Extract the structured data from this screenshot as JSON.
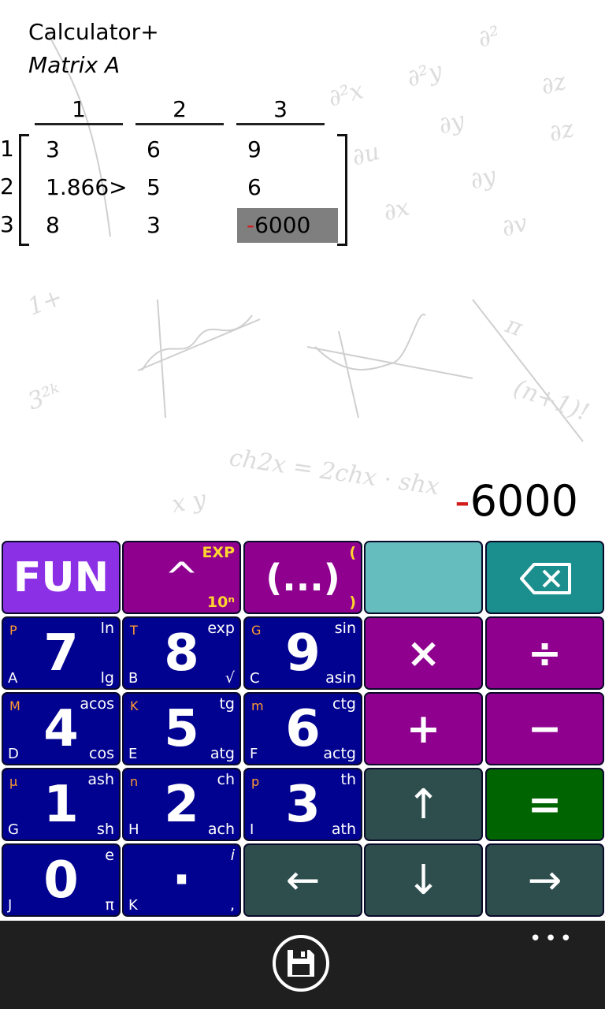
{
  "header": {
    "title": "Calculator+",
    "subtitle": "Matrix A"
  },
  "matrix": {
    "col_headers": [
      "1",
      "2",
      "3"
    ],
    "row_headers": [
      "1",
      "2",
      "3"
    ],
    "rows": [
      [
        "3",
        "6",
        "9"
      ],
      [
        "1.866>",
        "5",
        "6"
      ],
      [
        "8",
        "3",
        "6000"
      ]
    ],
    "selected_sign": "-"
  },
  "display": {
    "sign": "-",
    "value": "6000"
  },
  "keys": {
    "fun": "FUN",
    "pow": {
      "main": "^",
      "tr": "EXP",
      "br": "10ⁿ"
    },
    "paren": {
      "main": "(...)",
      "tr": "(",
      "br": ")"
    },
    "k7": {
      "main": "7",
      "tl": "P",
      "tr": "ln",
      "bl": "A",
      "br": "lg"
    },
    "k8": {
      "main": "8",
      "tl": "T",
      "tr": "exp",
      "bl": "B",
      "br": "√"
    },
    "k9": {
      "main": "9",
      "tl": "G",
      "tr": "sin",
      "bl": "C",
      "br": "asin"
    },
    "k4": {
      "main": "4",
      "tl": "M",
      "tr": "acos",
      "bl": "D",
      "br": "cos"
    },
    "k5": {
      "main": "5",
      "tl": "K",
      "tr": "tg",
      "bl": "E",
      "br": "atg"
    },
    "k6": {
      "main": "6",
      "tl": "m",
      "tr": "ctg",
      "bl": "F",
      "br": "actg"
    },
    "k1": {
      "main": "1",
      "tl": "μ",
      "tr": "ash",
      "bl": "G",
      "br": "sh"
    },
    "k2": {
      "main": "2",
      "tl": "n",
      "tr": "ch",
      "bl": "H",
      "br": "ach"
    },
    "k3": {
      "main": "3",
      "tl": "p",
      "tr": "th",
      "bl": "I",
      "br": "ath"
    },
    "k0": {
      "main": "0",
      "tr": "e",
      "bl": "J",
      "br": "π"
    },
    "dot": {
      "main": "·",
      "tr": "i",
      "bl": "K",
      "br": ","
    },
    "mul": "×",
    "div": "÷",
    "plus": "+",
    "minus": "−",
    "up": "↑",
    "equals": "=",
    "left": "←",
    "down": "↓",
    "right": "→"
  },
  "appbar": {
    "more": "•••"
  }
}
